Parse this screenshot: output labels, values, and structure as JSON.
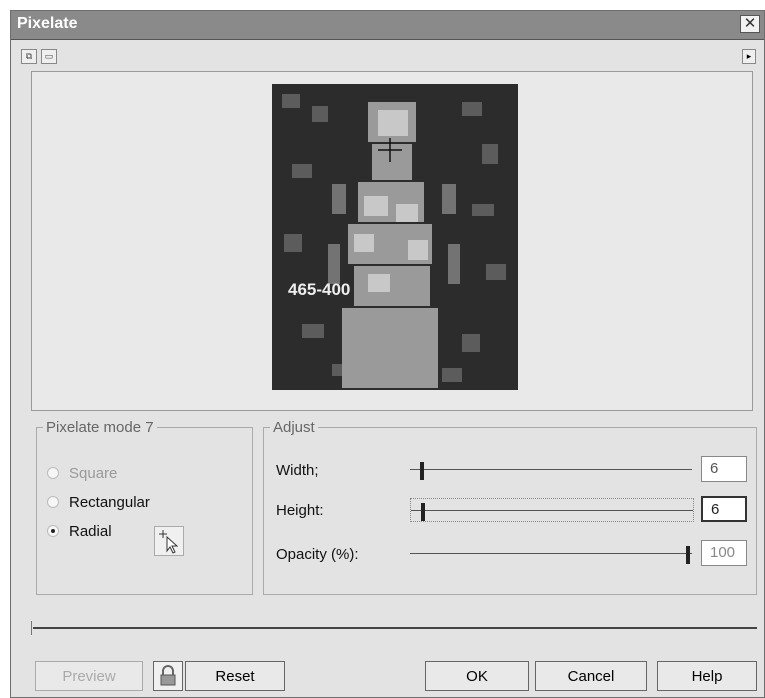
{
  "window": {
    "title": "Pixelate",
    "close_glyph": "✕"
  },
  "toolbar": {
    "buttons": [
      "preview-toggle-icon",
      "split-view-icon"
    ],
    "arrow_glyph": "▸"
  },
  "preview": {
    "coordinate_readout": "465-400"
  },
  "mode": {
    "legend": "Pixelate mode 7",
    "options": [
      {
        "label": "Square",
        "checked": false,
        "enabled": false
      },
      {
        "label": "Rectangular",
        "checked": false,
        "enabled": true
      },
      {
        "label": "Radial",
        "checked": true,
        "enabled": true
      }
    ]
  },
  "adjust": {
    "legend": "Adjust",
    "width": {
      "label": "Width;",
      "value": "6"
    },
    "height": {
      "label": "Height:",
      "value": "6"
    },
    "opacity": {
      "label": "Opacity (%):",
      "value": "100"
    }
  },
  "buttons": {
    "preview": "Preview",
    "reset": "Reset",
    "ok": "OK",
    "cancel": "Cancel",
    "help": "Help"
  },
  "colors": {
    "titlebar": "#8a8a8a",
    "dialog": "#e3e3e3",
    "disabled_text": "#9a9a9a"
  }
}
